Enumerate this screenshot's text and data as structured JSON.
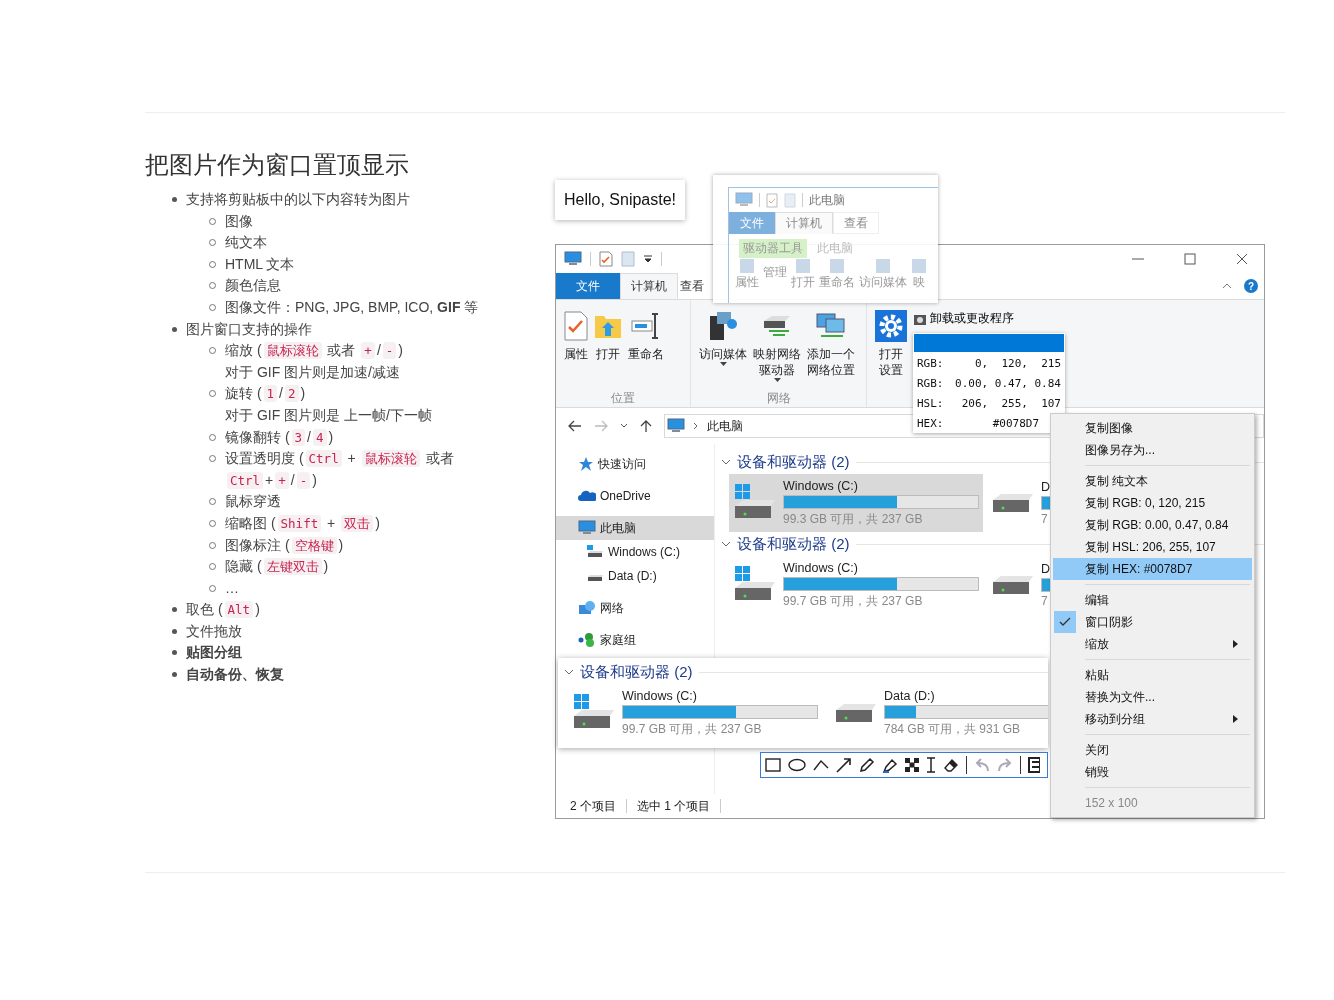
{
  "article": {
    "title": "把图片作为窗口置顶显示",
    "items": [
      {
        "bold": false,
        "parts": [
          {
            "kind": "text",
            "text": "支持将剪贴板中的以下内容转为图片"
          }
        ],
        "children": [
          {
            "parts": [
              {
                "kind": "text",
                "text": "图像"
              }
            ]
          },
          {
            "parts": [
              {
                "kind": "text",
                "text": "纯文本"
              }
            ]
          },
          {
            "parts": [
              {
                "kind": "text",
                "text": "HTML 文本"
              }
            ]
          },
          {
            "parts": [
              {
                "kind": "text",
                "text": "颜色信息"
              }
            ]
          },
          {
            "parts": [
              {
                "kind": "text",
                "text": "图像文件：PNG, JPG, BMP, ICO, **GIF** 等"
              }
            ]
          }
        ]
      },
      {
        "bold": false,
        "parts": [
          {
            "kind": "text",
            "text": "图片窗口支持的操作"
          }
        ],
        "children": [
          {
            "parts": [
              {
                "kind": "text",
                "text": "缩放 ("
              },
              {
                "kind": "code",
                "text": "鼠标滚轮"
              },
              {
                "kind": "text",
                "text": " 或者 "
              },
              {
                "kind": "code",
                "text": "+"
              },
              {
                "kind": "text",
                "text": "/"
              },
              {
                "kind": "code",
                "text": "-"
              },
              {
                "kind": "text",
                "text": ")"
              }
            ],
            "note": "对于 GIF 图片则是加速/减速"
          },
          {
            "parts": [
              {
                "kind": "text",
                "text": "旋转 ("
              },
              {
                "kind": "code",
                "text": "1"
              },
              {
                "kind": "text",
                "text": "/"
              },
              {
                "kind": "code",
                "text": "2"
              },
              {
                "kind": "text",
                "text": ")"
              }
            ],
            "note": "对于 GIF 图片则是 上一帧/下一帧"
          },
          {
            "parts": [
              {
                "kind": "text",
                "text": "镜像翻转 ("
              },
              {
                "kind": "code",
                "text": "3"
              },
              {
                "kind": "text",
                "text": "/"
              },
              {
                "kind": "code",
                "text": "4"
              },
              {
                "kind": "text",
                "text": ")"
              }
            ]
          },
          {
            "parts": [
              {
                "kind": "text",
                "text": "设置透明度 ("
              },
              {
                "kind": "code",
                "text": "Ctrl"
              },
              {
                "kind": "text",
                "text": " + "
              },
              {
                "kind": "code",
                "text": "鼠标滚轮"
              },
              {
                "kind": "text",
                "text": " 或者 "
              },
              {
                "kind": "code",
                "text": "Ctrl"
              },
              {
                "kind": "text",
                "text": "+"
              },
              {
                "kind": "code",
                "text": "+"
              },
              {
                "kind": "text",
                "text": "/"
              },
              {
                "kind": "code",
                "text": "-"
              },
              {
                "kind": "text",
                "text": ")"
              }
            ]
          },
          {
            "parts": [
              {
                "kind": "text",
                "text": "鼠标穿透"
              }
            ]
          },
          {
            "parts": [
              {
                "kind": "text",
                "text": "缩略图 ("
              },
              {
                "kind": "code",
                "text": "Shift"
              },
              {
                "kind": "text",
                "text": " + "
              },
              {
                "kind": "code",
                "text": "双击"
              },
              {
                "kind": "text",
                "text": ")"
              }
            ]
          },
          {
            "parts": [
              {
                "kind": "text",
                "text": "图像标注 ("
              },
              {
                "kind": "code",
                "text": "空格键"
              },
              {
                "kind": "text",
                "text": ")"
              }
            ]
          },
          {
            "parts": [
              {
                "kind": "text",
                "text": "隐藏 ("
              },
              {
                "kind": "code",
                "text": "左键双击"
              },
              {
                "kind": "text",
                "text": ")"
              }
            ]
          },
          {
            "parts": [
              {
                "kind": "text",
                "text": "…"
              }
            ]
          }
        ]
      },
      {
        "bold": false,
        "parts": [
          {
            "kind": "text",
            "text": "取色 ("
          },
          {
            "kind": "code",
            "text": "Alt"
          },
          {
            "kind": "text",
            "text": ")"
          }
        ]
      },
      {
        "bold": false,
        "parts": [
          {
            "kind": "text",
            "text": "文件拖放"
          }
        ]
      },
      {
        "bold": true,
        "parts": [
          {
            "kind": "text",
            "text": "贴图分组"
          }
        ]
      },
      {
        "bold": true,
        "parts": [
          {
            "kind": "text",
            "text": "自动备份、恢复"
          }
        ]
      }
    ]
  },
  "figure": {
    "note_card": {
      "text": "Hello, Snipaste!"
    },
    "explorer": {
      "tabs": [
        {
          "label": "文件",
          "kind": "file",
          "selected": false
        },
        {
          "label": "计算机",
          "kind": "tab",
          "selected": true
        },
        {
          "label": "查看",
          "kind": "tab",
          "selected": false
        }
      ],
      "help_label": "?",
      "ribbon_groups": [
        {
          "label": "位置",
          "items": [
            {
              "lines": [
                "属性"
              ],
              "dropdown": false
            },
            {
              "lines": [
                "打开"
              ],
              "dropdown": false
            },
            {
              "lines": [
                "重命名"
              ],
              "dropdown": false
            }
          ]
        },
        {
          "label": "网络",
          "items": [
            {
              "lines": [
                "访问媒体"
              ],
              "dropdown": true
            },
            {
              "lines": [
                "映射网络",
                "驱动器"
              ],
              "dropdown": true
            },
            {
              "lines": [
                "添加一个",
                "网络位置"
              ],
              "dropdown": false
            }
          ]
        },
        {
          "items": [
            {
              "lines": [
                "打开",
                "设置"
              ],
              "dropdown": false
            }
          ],
          "small_items": [
            {
              "label": "卸载或更改程序"
            }
          ]
        }
      ],
      "address": {
        "crumb": "此电脑"
      },
      "nav": [
        {
          "label": "快速访问",
          "selected": false
        },
        {
          "label": "OneDrive",
          "selected": false
        },
        {
          "label": "此电脑",
          "selected": true,
          "children": [
            {
              "label": "Windows (C:)",
              "selected": false
            },
            {
              "label": "Data (D:)",
              "selected": false
            }
          ]
        },
        {
          "label": "网络",
          "selected": false
        },
        {
          "label": "家庭组",
          "selected": false
        }
      ],
      "groups": [
        {
          "title": "设备和驱动器 (2)",
          "expanded": true,
          "drives": [
            {
              "name": "Windows (C:)",
              "level": 0.58,
              "info": "99.3 GB 可用，共 237 GB",
              "selected": true
            },
            {
              "name": "D",
              "level": 0.16,
              "info": "7",
              "selected": false
            }
          ]
        },
        {
          "title": "设备和驱动器 (2)",
          "expanded": true,
          "drives": [
            {
              "name": "Windows (C:)",
              "level": 0.58,
              "info": "99.7 GB 可用，共 237 GB",
              "selected": false
            },
            {
              "name": "D",
              "level": 0.16,
              "info": "7",
              "selected": false
            }
          ]
        }
      ],
      "status": [
        "2 个项目",
        "选中 1 个项目"
      ]
    },
    "ghost": {
      "title": "此电脑",
      "tabs": [
        {
          "label": "文件",
          "kind": "file",
          "selected": false
        },
        {
          "label": "计算机",
          "kind": "tab",
          "selected": true
        },
        {
          "label": "查看",
          "kind": "tab",
          "selected": false
        }
      ],
      "context_tab": "驱动器工具",
      "context_title": "此电脑",
      "items": [
        {
          "label": "属性",
          "kind": "button"
        },
        {
          "label": "管理",
          "kind": "tab"
        },
        {
          "label": "打开",
          "kind": "button"
        },
        {
          "label": "重命名",
          "kind": "button"
        },
        {
          "label": "访问媒体",
          "kind": "button"
        },
        {
          "label": "映",
          "kind": "button"
        }
      ]
    },
    "color_info": {
      "color": "#0078d7",
      "rows": [
        {
          "label": "RGB:",
          "value": "0,  120,  215"
        },
        {
          "label": "RGB:",
          "value": "0.00, 0.47, 0.84"
        },
        {
          "label": "HSL:",
          "value": "206,  255,  107"
        },
        {
          "label": "HEX:",
          "value": "#0078D7"
        }
      ]
    },
    "snippet": {
      "title": "设备和驱动器 (2)",
      "expanded": true,
      "drives": [
        {
          "name": "Windows (C:)",
          "level": 0.58,
          "info": "99.7 GB 可用，共 237 GB"
        },
        {
          "name": "Data (D:)",
          "level": 0.16,
          "info": "784 GB 可用，共 931 GB"
        }
      ]
    },
    "menu": {
      "sections": [
        [
          {
            "label": "复制图像",
            "selected": false,
            "checked": false,
            "submenu": false
          },
          {
            "label": "图像另存为...",
            "selected": false,
            "checked": false,
            "submenu": false
          }
        ],
        [
          {
            "label": "复制 纯文本",
            "selected": false,
            "checked": false,
            "submenu": false
          },
          {
            "label": "复制 RGB: 0, 120, 215",
            "selected": false,
            "checked": false,
            "submenu": false
          },
          {
            "label": "复制 RGB: 0.00, 0.47, 0.84",
            "selected": false,
            "checked": false,
            "submenu": false
          },
          {
            "label": "复制 HSL: 206, 255, 107",
            "selected": false,
            "checked": false,
            "submenu": false
          },
          {
            "label": "复制 HEX: #0078D7",
            "selected": true,
            "checked": false,
            "submenu": false
          }
        ],
        [
          {
            "label": "编辑",
            "selected": false,
            "checked": false,
            "submenu": false
          },
          {
            "label": "窗口阴影",
            "selected": false,
            "checked": true,
            "submenu": false
          },
          {
            "label": "缩放",
            "selected": false,
            "checked": false,
            "submenu": true
          }
        ],
        [
          {
            "label": "粘贴",
            "selected": false,
            "checked": false,
            "submenu": false
          },
          {
            "label": "替换为文件...",
            "selected": false,
            "checked": false,
            "submenu": false
          },
          {
            "label": "移动到分组",
            "selected": false,
            "checked": false,
            "submenu": true
          }
        ],
        [
          {
            "label": "关闭",
            "selected": false,
            "checked": false,
            "submenu": false
          },
          {
            "label": "销毁",
            "selected": false,
            "checked": false,
            "submenu": false
          }
        ]
      ],
      "footer": "152 x 100"
    }
  }
}
